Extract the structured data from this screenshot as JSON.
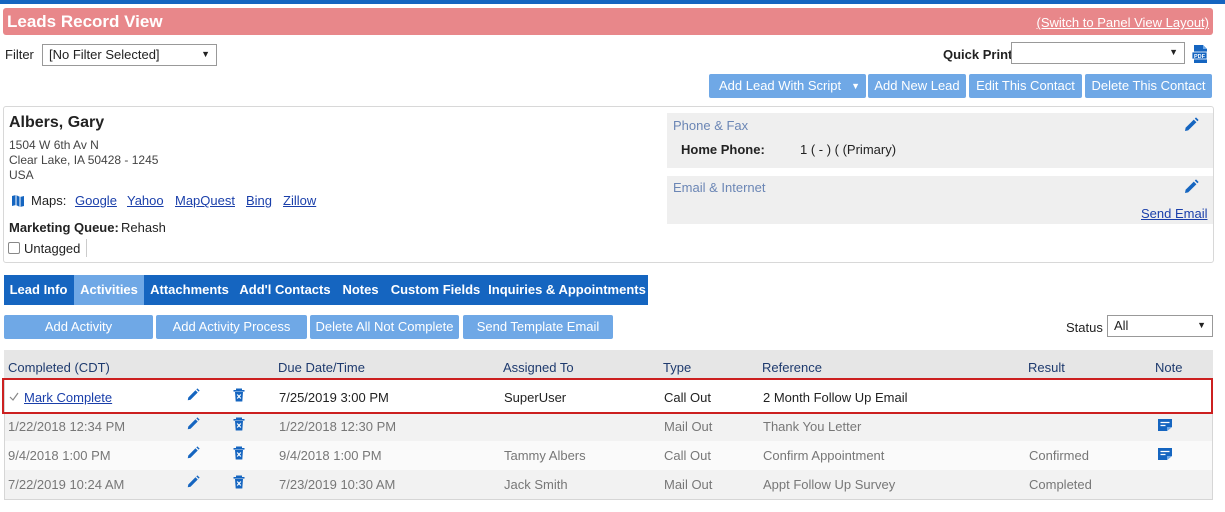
{
  "colors": {
    "title_bar": "#e8878a",
    "button": "#6fa8e6",
    "tab_bar": "#1565c0",
    "tab_active": "#6fa8e6",
    "highlight_border": "#cc2020",
    "link": "#1a3faa"
  },
  "header": {
    "title": "Leads Record View",
    "switch_link": "(Switch to Panel View Layout)"
  },
  "filter": {
    "label": "Filter",
    "selected": "[No Filter Selected]"
  },
  "quick_print": {
    "label": "Quick Print",
    "selected": ""
  },
  "actions": {
    "add_lead_script": "Add Lead With Script",
    "add_new_lead": "Add New Lead",
    "edit_contact": "Edit This Contact",
    "delete_contact": "Delete This Contact"
  },
  "contact": {
    "name": "Albers, Gary",
    "address_line1": "1504 W 6th Av N",
    "address_line2": "Clear Lake, IA 50428 - 1245",
    "address_line3": "USA",
    "maps_label": "Maps:",
    "map_links": [
      "Google",
      "Yahoo",
      "MapQuest",
      "Bing",
      "Zillow"
    ],
    "marketing_queue_label": "Marketing Queue:",
    "marketing_queue_value": "Rehash",
    "untagged_label": "Untagged"
  },
  "phone_fax": {
    "title": "Phone & Fax",
    "home_phone_label": "Home Phone:",
    "home_phone_value": "1 ( - ) ( (Primary)"
  },
  "email_internet": {
    "title": "Email & Internet",
    "send_email": "Send Email"
  },
  "tabs": [
    {
      "label": "Lead Info",
      "active": false
    },
    {
      "label": "Activities",
      "active": true
    },
    {
      "label": "Attachments",
      "active": false
    },
    {
      "label": "Add'l Contacts",
      "active": false
    },
    {
      "label": "Notes",
      "active": false
    },
    {
      "label": "Custom Fields",
      "active": false
    },
    {
      "label": "Inquiries & Appointments",
      "active": false
    }
  ],
  "activity_buttons": {
    "add_activity": "Add Activity",
    "add_activity_process": "Add Activity Process",
    "delete_not_complete": "Delete All Not Complete",
    "send_template": "Send Template Email"
  },
  "status": {
    "label": "Status",
    "selected": "All"
  },
  "table": {
    "columns": [
      "Completed (CDT)",
      "Due Date/Time",
      "Assigned To",
      "Type",
      "Reference",
      "Result",
      "Note"
    ],
    "rows": [
      {
        "completed": "Mark Complete",
        "due": "7/25/2019 3:00 PM",
        "assigned": "SuperUser",
        "type": "Call Out",
        "reference": "2 Month Follow Up Email",
        "result": "",
        "has_note": false
      },
      {
        "completed": "1/22/2018 12:34 PM",
        "due": "1/22/2018 12:30 PM",
        "assigned": "",
        "type": "Mail Out",
        "reference": "Thank You Letter",
        "result": "",
        "has_note": true
      },
      {
        "completed": "9/4/2018 1:00 PM",
        "due": "9/4/2018 1:00 PM",
        "assigned": "Tammy Albers",
        "type": "Call Out",
        "reference": "Confirm Appointment",
        "result": "Confirmed",
        "has_note": true
      },
      {
        "completed": "7/22/2019 10:24 AM",
        "due": "7/23/2019 10:30 AM",
        "assigned": "Jack Smith",
        "type": "Mail Out",
        "reference": "Appt Follow Up Survey",
        "result": "Completed",
        "has_note": false
      }
    ]
  }
}
